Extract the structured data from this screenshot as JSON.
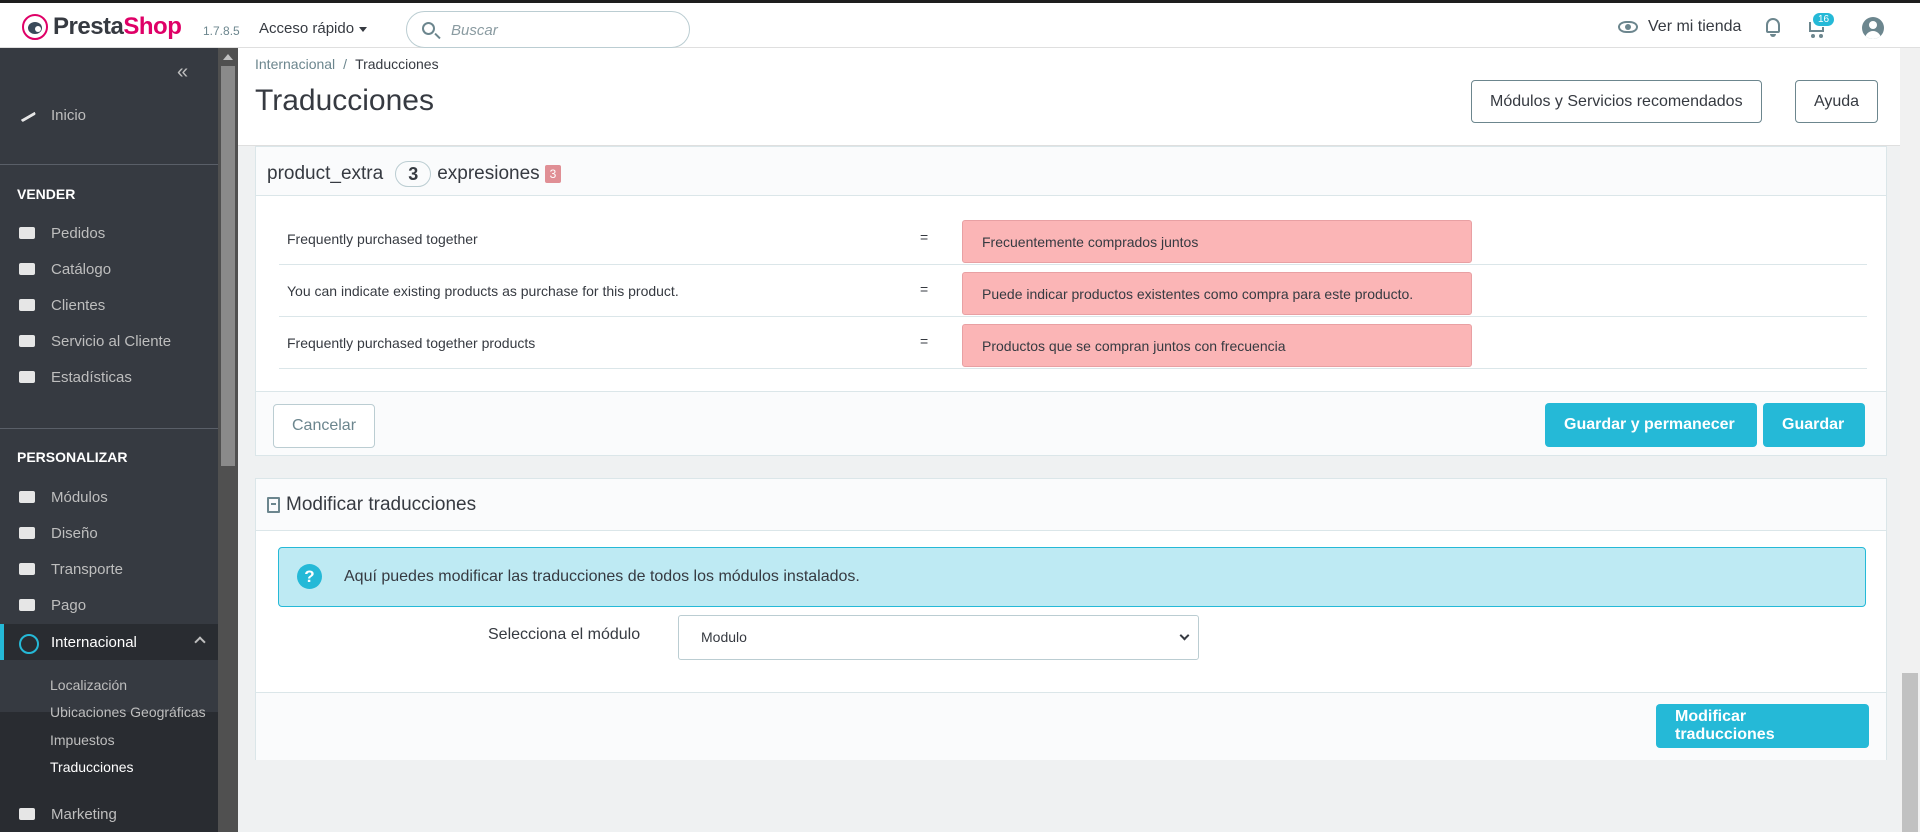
{
  "header": {
    "logo_presta": "Presta",
    "logo_shop": "Shop",
    "version": "1.7.8.5",
    "quick_access": "Acceso rápido",
    "search_placeholder": "Buscar",
    "view_store": "Ver mi tienda",
    "cart_count": "16"
  },
  "sidebar": {
    "home": "Inicio",
    "section_sell": "VENDER",
    "sell_items": [
      "Pedidos",
      "Catálogo",
      "Clientes",
      "Servicio al Cliente",
      "Estadísticas"
    ],
    "section_customize": "PERSONALIZAR",
    "customize_items": [
      "Módulos",
      "Diseño",
      "Transporte",
      "Pago",
      "Internacional"
    ],
    "sub_items": [
      "Localización",
      "Ubicaciones Geográficas",
      "Impuestos",
      "Traducciones"
    ],
    "marketing": "Marketing"
  },
  "page": {
    "breadcrumb_parent": "Internacional",
    "breadcrumb_current": "Traducciones",
    "title": "Traducciones",
    "btn_recommended": "Módulos y Servicios recomendados",
    "btn_help": "Ayuda"
  },
  "translations_card": {
    "module_name": "product_extra",
    "count": "3",
    "expressions_label": "expresiones",
    "missing_count": "3",
    "rows": [
      {
        "source": "Frequently purchased together",
        "equals": "=",
        "translation": "Frecuentemente comprados juntos"
      },
      {
        "source": "You can indicate existing products as purchase for this product.",
        "equals": "=",
        "translation": "Puede indicar productos existentes como compra para este producto."
      },
      {
        "source": "Frequently purchased together products",
        "equals": "=",
        "translation": "Productos que se compran juntos con frecuencia"
      }
    ],
    "btn_cancel": "Cancelar",
    "btn_save_stay": "Guardar y permanecer",
    "btn_save": "Guardar"
  },
  "modify_card": {
    "title": "Modificar traducciones",
    "info": "Aquí puedes modificar las traducciones de todos los módulos instalados.",
    "select_label": "Selecciona el módulo",
    "select_value": "Modulo",
    "btn_modify": "Modificar traducciones"
  },
  "colors": {
    "accent": "#25b9d7",
    "brand": "#df0067",
    "missing": "#fbb5b6"
  }
}
